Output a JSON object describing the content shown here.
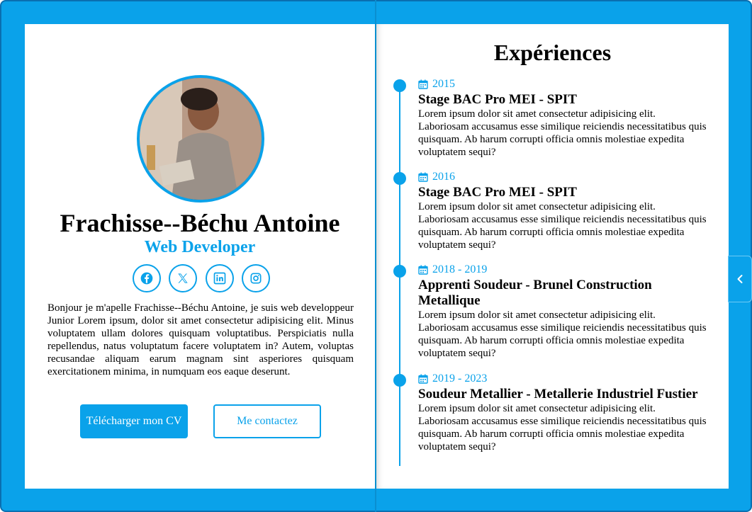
{
  "profile": {
    "name": "Frachisse--Béchu Antoine",
    "role": "Web Developer",
    "bio": "Bonjour je m'apelle Frachisse--Béchu Antoine, je suis web developpeur Junior Lorem ipsum, dolor sit amet consectetur adipisicing elit. Minus voluptatem ullam dolores quisquam voluptatibus. Perspiciatis nulla repellendus, natus voluptatum facere voluptatem in? Autem, voluptas recusandae aliquam earum magnam sint asperiores quisquam exercitationem minima, in numquam eos eaque deserunt.",
    "socials": [
      "facebook-icon",
      "x-icon",
      "linkedin-icon",
      "instagram-icon"
    ],
    "cv_button": "Télécharger mon CV",
    "contact_button": "Me contactez"
  },
  "experiences": {
    "title": "Expériences",
    "items": [
      {
        "date": "2015",
        "job": "Stage BAC Pro MEI - SPIT",
        "desc": "Lorem ipsum dolor sit amet consectetur adipisicing elit. Laboriosam accusamus esse similique reiciendis necessitatibus quis quisquam. Ab harum corrupti officia omnis molestiae expedita voluptatem sequi?"
      },
      {
        "date": "2016",
        "job": "Stage BAC Pro MEI - SPIT",
        "desc": "Lorem ipsum dolor sit amet consectetur adipisicing elit. Laboriosam accusamus esse similique reiciendis necessitatibus quis quisquam. Ab harum corrupti officia omnis molestiae expedita voluptatem sequi?"
      },
      {
        "date": "2018 - 2019",
        "job": "Apprenti Soudeur - Brunel Construction Metallique",
        "desc": "Lorem ipsum dolor sit amet consectetur adipisicing elit. Laboriosam accusamus esse similique reiciendis necessitatibus quis quisquam. Ab harum corrupti officia omnis molestiae expedita voluptatem sequi?"
      },
      {
        "date": "2019 - 2023",
        "job": "Soudeur Metallier - Metallerie Industriel Fustier",
        "desc": "Lorem ipsum dolor sit amet consectetur adipisicing elit. Laboriosam accusamus esse similique reiciendis necessitatibus quis quisquam. Ab harum corrupti officia omnis molestiae expedita voluptatem sequi?"
      }
    ]
  },
  "colors": {
    "accent": "#0aa2ea",
    "frame": "#0a6fb0"
  },
  "icons": {
    "calendar": "calendar-icon",
    "page_tab": "chevron-left-icon"
  }
}
